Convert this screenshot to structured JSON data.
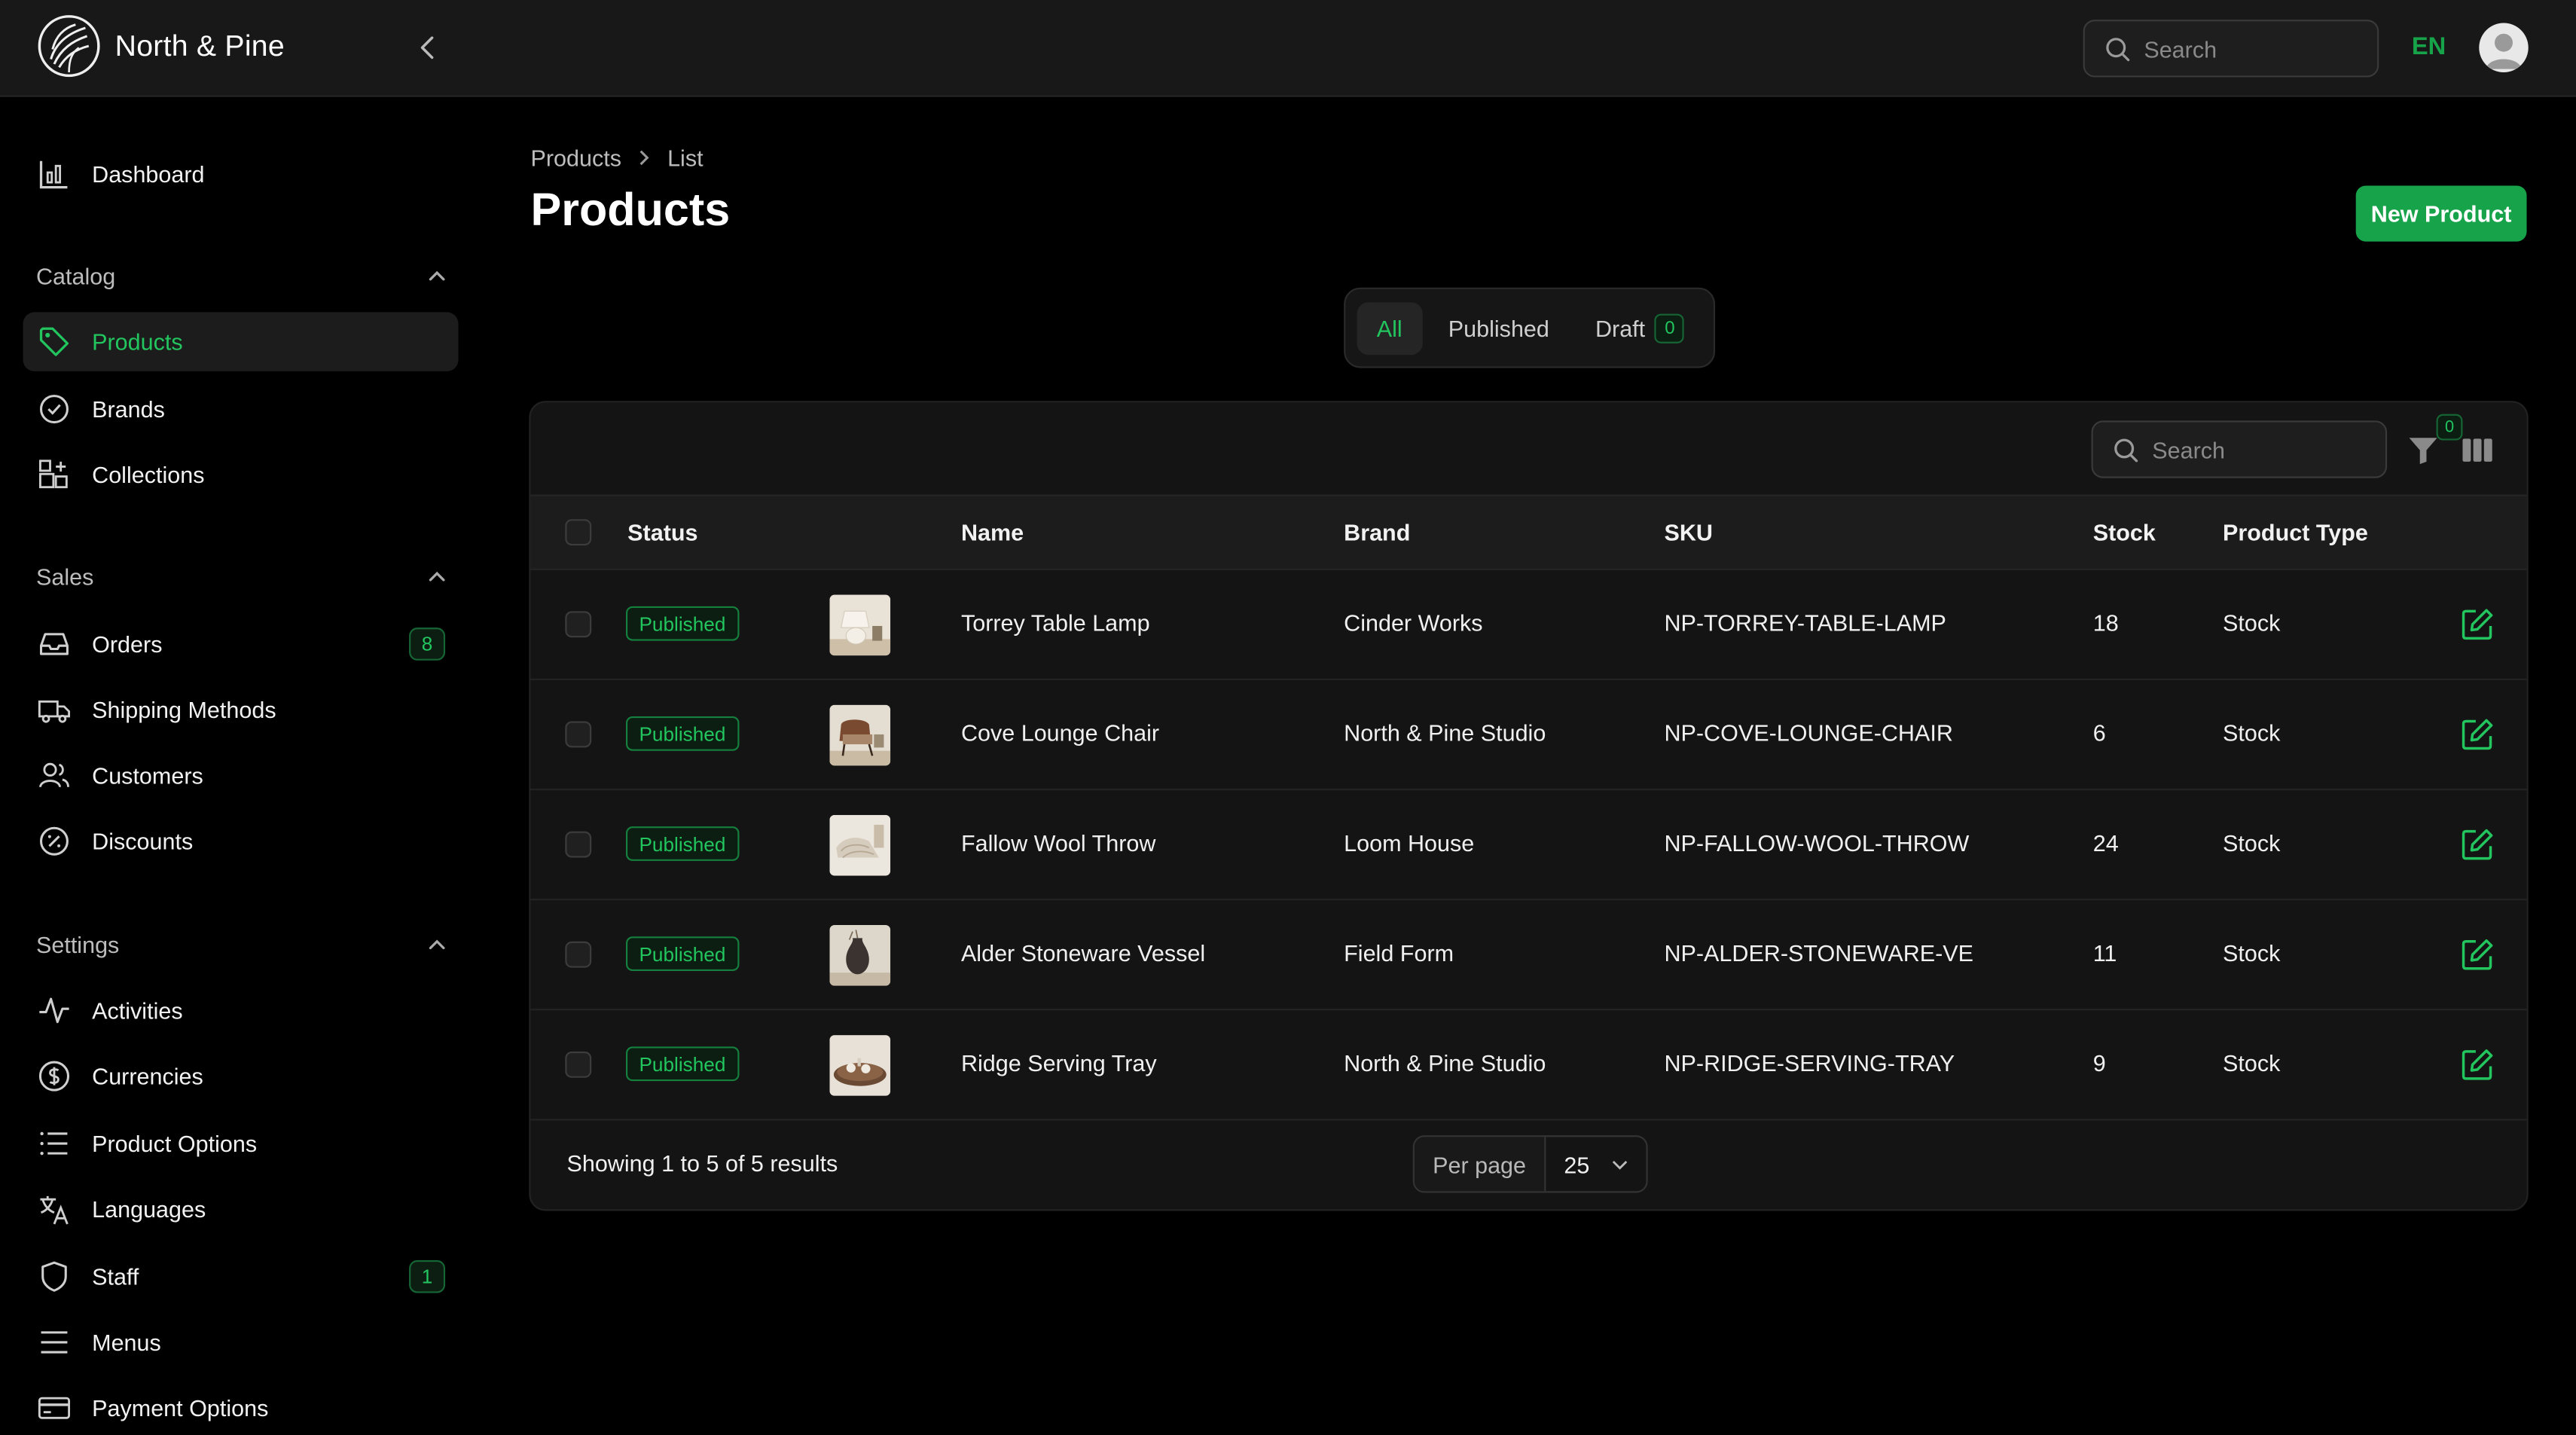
{
  "app": {
    "name": "North & Pine"
  },
  "topbar": {
    "search_placeholder": "Search",
    "language": "EN"
  },
  "sidebar": {
    "dashboard": "Dashboard",
    "catalog": {
      "title": "Catalog",
      "items": [
        "Products",
        "Brands",
        "Collections"
      ]
    },
    "sales": {
      "title": "Sales",
      "items": [
        "Orders",
        "Shipping Methods",
        "Customers",
        "Discounts"
      ],
      "orders_badge": "8"
    },
    "settings": {
      "title": "Settings",
      "items": [
        "Activities",
        "Currencies",
        "Product Options",
        "Languages",
        "Staff",
        "Menus",
        "Payment Options"
      ],
      "staff_badge": "1"
    }
  },
  "breadcrumb": {
    "root": "Products",
    "current": "List"
  },
  "page": {
    "title": "Products",
    "new_button": "New Product"
  },
  "tabs": {
    "all": "All",
    "published": "Published",
    "draft": "Draft",
    "draft_count": "0"
  },
  "table": {
    "search_placeholder": "Search",
    "filter_count": "0",
    "headers": {
      "status": "Status",
      "name": "Name",
      "brand": "Brand",
      "sku": "SKU",
      "stock": "Stock",
      "type": "Product Type"
    },
    "rows": [
      {
        "status": "Published",
        "name": "Torrey Table Lamp",
        "brand": "Cinder Works",
        "sku": "NP-TORREY-TABLE-LAMP",
        "stock": "18",
        "type": "Stock"
      },
      {
        "status": "Published",
        "name": "Cove Lounge Chair",
        "brand": "North & Pine Studio",
        "sku": "NP-COVE-LOUNGE-CHAIR",
        "stock": "6",
        "type": "Stock"
      },
      {
        "status": "Published",
        "name": "Fallow Wool Throw",
        "brand": "Loom House",
        "sku": "NP-FALLOW-WOOL-THROW",
        "stock": "24",
        "type": "Stock"
      },
      {
        "status": "Published",
        "name": "Alder Stoneware Vessel",
        "brand": "Field Form",
        "sku": "NP-ALDER-STONEWARE-VE",
        "stock": "11",
        "type": "Stock"
      },
      {
        "status": "Published",
        "name": "Ridge Serving Tray",
        "brand": "North & Pine Studio",
        "sku": "NP-RIDGE-SERVING-TRAY",
        "stock": "9",
        "type": "Stock"
      }
    ],
    "footer": "Showing 1 to 5 of 5 results",
    "per_page_label": "Per page",
    "per_page_value": "25"
  },
  "colors": {
    "accent": "#22c55e",
    "button": "#16a34a",
    "background": "#000000",
    "panel": "#141414"
  }
}
